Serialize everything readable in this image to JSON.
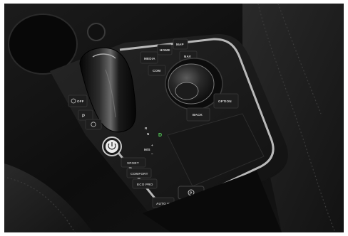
{
  "console": {
    "buttons": {
      "media": "MEDIA",
      "home": "HOME",
      "map": "MAP",
      "com": "COM",
      "nav": "NAV",
      "back": "BACK",
      "option": "OPTION",
      "sport": "SPORT",
      "comfort": "COMFORT",
      "eco_pro": "ECO PRO",
      "auto_h": "AUTO H",
      "dsc_off": "OFF"
    },
    "gear_indicator": [
      "R",
      "N",
      "D",
      "M/S"
    ],
    "plus_minus": [
      "+",
      "−"
    ],
    "park_label": "P",
    "active_gear_color": "#55d05a",
    "icons": [
      "start-stop-icon",
      "parking-brake-icon",
      "dsc-off-icon",
      "parking-assist-icon",
      "idrive-controller-icon"
    ]
  }
}
